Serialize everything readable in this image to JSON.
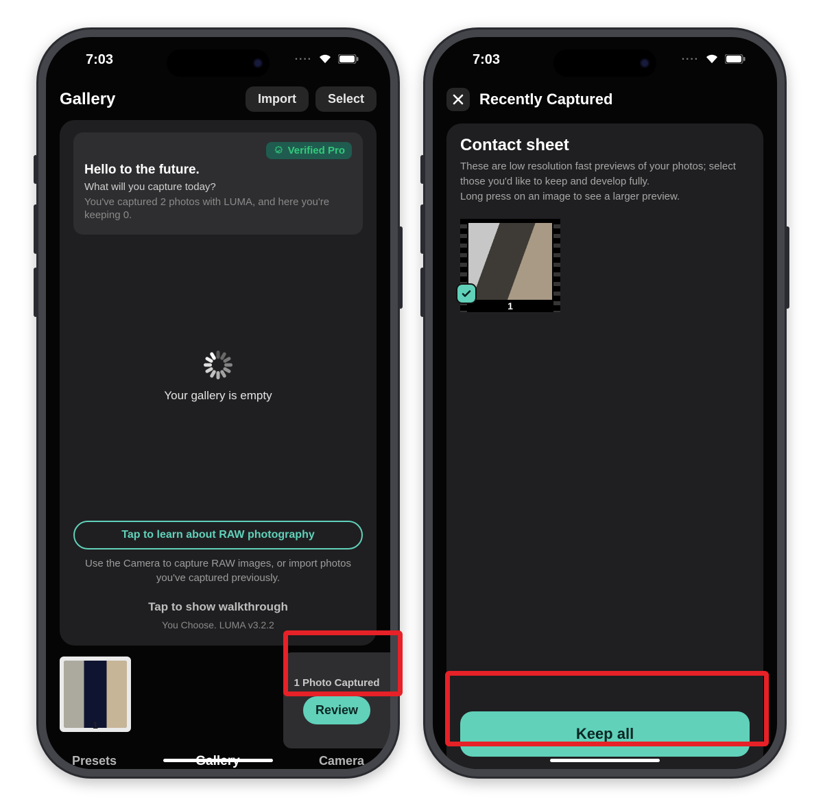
{
  "status": {
    "time": "7:03",
    "dots": "····"
  },
  "left": {
    "header": {
      "title": "Gallery",
      "import": "Import",
      "select": "Select"
    },
    "badge": "Verified Pro",
    "card": {
      "hello": "Hello to the future.",
      "question": "What will you capture today?",
      "stats": "You've captured 2 photos with LUMA, and here you're keeping 0."
    },
    "empty": "Your gallery is empty",
    "learn": "Tap to learn about RAW photography",
    "helper": "Use the Camera to capture RAW images, or import photos you've captured previously.",
    "walkthrough": "Tap to show walkthrough",
    "version": "You Choose. LUMA v3.2.2",
    "thumb_label": "1",
    "capture_text": "1 Photo Captured",
    "review": "Review",
    "tabs": {
      "presets": "Presets",
      "gallery": "Gallery",
      "camera": "Camera"
    }
  },
  "right": {
    "title": "Recently Captured",
    "heading": "Contact sheet",
    "desc1": "These are low resolution fast previews of your photos; select those you'd like to keep and develop fully.",
    "desc2": "Long press on an image to see a larger preview.",
    "thumb_label": "1",
    "keep": "Keep all"
  }
}
